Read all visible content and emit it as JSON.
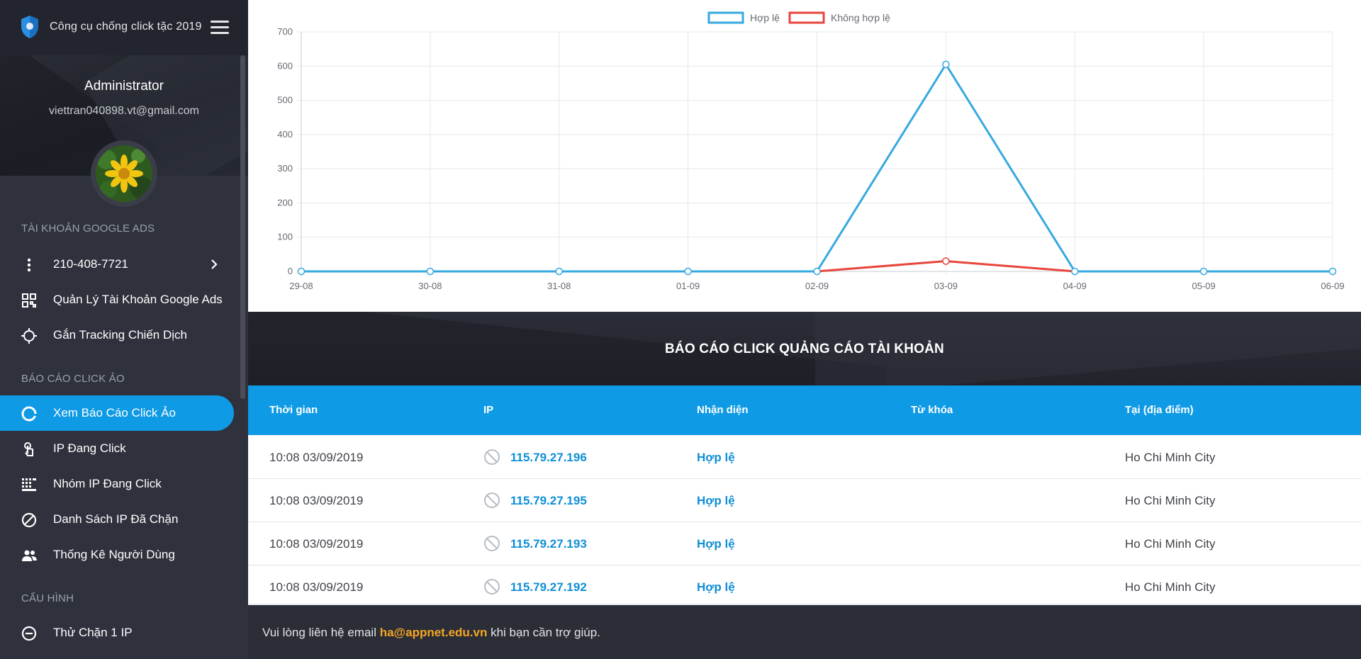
{
  "app": {
    "title": "Công cụ chống click tặc 2019"
  },
  "user": {
    "name": "Administrator",
    "email": "viettran040898.vt@gmail.com"
  },
  "sidebar": {
    "sections": [
      "Tài khoản Google Ads",
      "Báo cáo click ảo",
      "Cấu hình"
    ],
    "account_id": "210-408-7721",
    "items": [
      {
        "label": "Quản Lý Tài Khoản Google Ads",
        "icon": "dashboard-icon"
      },
      {
        "label": "Gắn Tracking Chiến Dịch",
        "icon": "crosshair-icon"
      },
      {
        "label": "Xem Báo Cáo Click Ảo",
        "icon": "donut-chart-icon",
        "active": true
      },
      {
        "label": "IP Đang Click",
        "icon": "touch-icon"
      },
      {
        "label": "Nhóm IP Đang Click",
        "icon": "grid-list-icon"
      },
      {
        "label": "Danh Sách IP Đã Chặn",
        "icon": "block-icon"
      },
      {
        "label": "Thống Kê Người Dùng",
        "icon": "people-icon"
      },
      {
        "label": "Thử Chặn 1 IP",
        "icon": "minus-circle-icon"
      }
    ]
  },
  "colors": {
    "accent": "#0e9ae5",
    "valid": "#36a9e1",
    "invalid": "#e8453c",
    "email": "#f5a623"
  },
  "chart_data": {
    "type": "line",
    "x": [
      "29-08",
      "30-08",
      "31-08",
      "01-09",
      "02-09",
      "03-09",
      "04-09",
      "05-09",
      "06-09"
    ],
    "series": [
      {
        "name": "Hợp lệ",
        "color": "#36a9e1",
        "values": [
          0,
          0,
          0,
          0,
          0,
          605,
          0,
          0,
          0
        ]
      },
      {
        "name": "Không hợp lệ",
        "color": "#e8453c",
        "values": [
          0,
          0,
          0,
          0,
          0,
          30,
          0,
          0,
          0
        ]
      }
    ],
    "yticks": [
      "0",
      "100",
      "200",
      "300",
      "400",
      "500",
      "600",
      "700"
    ],
    "ylim": [
      0,
      700
    ],
    "grid": true,
    "legend": "top"
  },
  "report": {
    "title": "BÁO CÁO CLICK QUẢNG CÁO TÀI KHOẢN",
    "columns": [
      "Thời gian",
      "IP",
      "Nhận diện",
      "Từ khóa",
      "Tại (địa điểm)"
    ],
    "rows": [
      {
        "time": "10:08 03/09/2019",
        "ip": "115.79.27.196",
        "status": "Hợp lệ",
        "keyword": "",
        "location": "Ho Chi Minh City"
      },
      {
        "time": "10:08 03/09/2019",
        "ip": "115.79.27.195",
        "status": "Hợp lệ",
        "keyword": "",
        "location": "Ho Chi Minh City"
      },
      {
        "time": "10:08 03/09/2019",
        "ip": "115.79.27.193",
        "status": "Hợp lệ",
        "keyword": "",
        "location": "Ho Chi Minh City"
      },
      {
        "time": "10:08 03/09/2019",
        "ip": "115.79.27.192",
        "status": "Hợp lệ",
        "keyword": "",
        "location": "Ho Chi Minh City"
      }
    ]
  },
  "footer": {
    "text_before": "Vui lòng liên hệ email",
    "email": "ha@appnet.edu.vn",
    "text_after": "khi bạn cần trợ giúp."
  }
}
